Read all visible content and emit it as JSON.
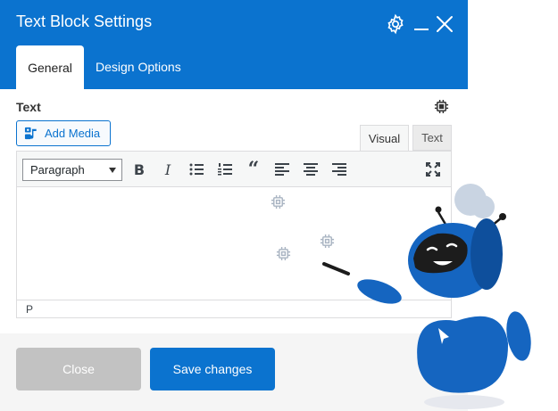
{
  "window": {
    "title": "Text Block Settings"
  },
  "tabs": [
    {
      "label": "General",
      "active": true
    },
    {
      "label": "Design Options",
      "active": false
    }
  ],
  "section": {
    "label": "Text"
  },
  "editor": {
    "add_media_label": "Add Media",
    "mode_tabs": [
      {
        "label": "Visual",
        "active": true
      },
      {
        "label": "Text",
        "active": false
      }
    ],
    "format_select": {
      "value": "Paragraph"
    },
    "toolbar_icons": [
      "bold-icon",
      "italic-icon",
      "bullet-list-icon",
      "numbered-list-icon",
      "blockquote-icon",
      "align-left-icon",
      "align-center-icon",
      "align-right-icon",
      "fullscreen-icon"
    ],
    "bold_glyph": "B",
    "italic_glyph": "I",
    "quote_glyph": "“",
    "content": "",
    "status_path": "P"
  },
  "footer": {
    "close_label": "Close",
    "save_label": "Save changes"
  },
  "colors": {
    "primary": "#0b73cf",
    "close_button": "#c2c2c2",
    "footer_bg": "#f5f5f5",
    "robot_blue": "#1565c0"
  }
}
